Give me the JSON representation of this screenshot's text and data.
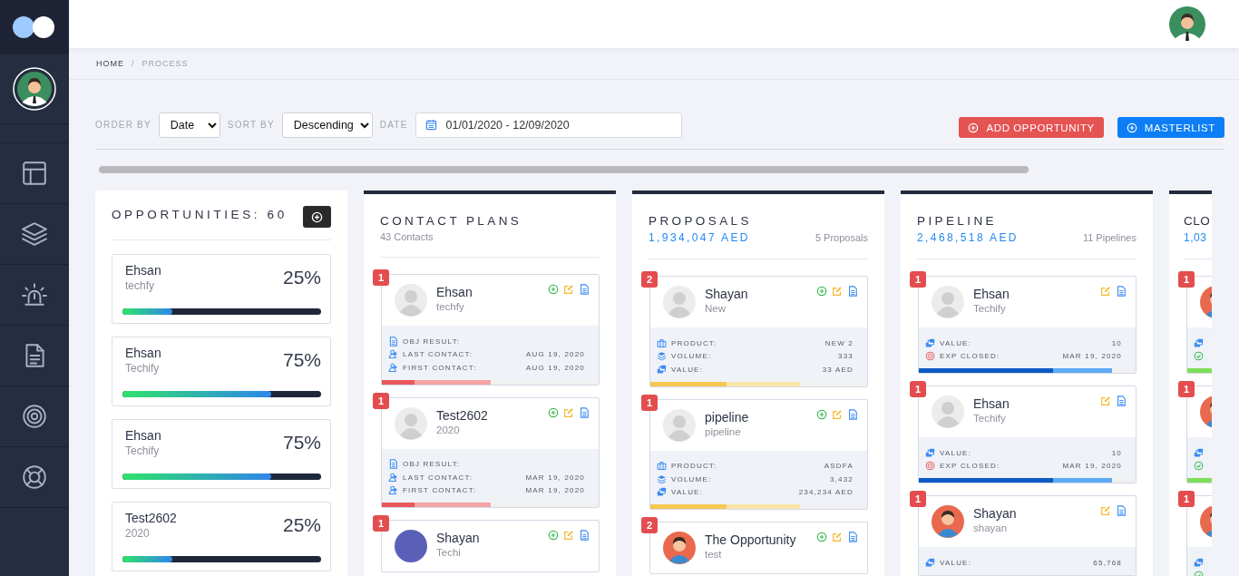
{
  "breadcrumb": {
    "separator": "/",
    "items": [
      {
        "label": "HOME",
        "current": false
      },
      {
        "label": "PROCESS",
        "current": true
      }
    ]
  },
  "filters": [
    {
      "label": "ORDER BY",
      "kind": "select",
      "value": "Date"
    },
    {
      "label": "SORT BY",
      "kind": "select",
      "value": "Descending"
    },
    {
      "label": "DATE",
      "kind": "daterange",
      "value": "01/01/2020 - 12/09/2020"
    }
  ],
  "actions": [
    {
      "label": "ADD OPPORTUNITY",
      "kind": "danger"
    },
    {
      "label": "MASTERLIST",
      "kind": "primary"
    }
  ],
  "opportunities": {
    "title": "OPPORTUNITIES: 60",
    "items": [
      {
        "name": "Ehsan",
        "company": "techfy",
        "percent": "25%",
        "level": 0.25
      },
      {
        "name": "Ehsan",
        "company": "Techify",
        "percent": "75%",
        "level": 0.75
      },
      {
        "name": "Ehsan",
        "company": "Techify",
        "percent": "75%",
        "level": 0.75
      },
      {
        "name": "Test2602",
        "company": "2020",
        "percent": "25%",
        "level": 0.25
      }
    ]
  },
  "stages": [
    {
      "kind": "contact",
      "title": "CONTACT PLANS",
      "count": "43 Contacts",
      "cards": [
        {
          "badge": "1",
          "avatar": {
            "kind": "placeholder"
          },
          "name": "Ehsan",
          "subtitle": "techfy",
          "actions": [
            {
              "kind": "add"
            },
            {
              "kind": "edit"
            },
            {
              "kind": "doc"
            }
          ],
          "fields": [
            {
              "kind": "doc",
              "label": "OBJ RESULT:"
            },
            {
              "kind": "contacts",
              "label": "LAST CONTACT:",
              "value": "AUG 19, 2020"
            },
            {
              "kind": "contacts",
              "label": "FIRST CONTACT:",
              "value": "AUG 19, 2020"
            }
          ],
          "progress": [
            {
              "level": 0.5
            },
            {
              "level": 0.15
            }
          ]
        },
        {
          "badge": "1",
          "avatar": {
            "kind": "placeholder"
          },
          "name": "Test2602",
          "subtitle": "2020",
          "actions": [
            {
              "kind": "add"
            },
            {
              "kind": "edit"
            },
            {
              "kind": "doc"
            }
          ],
          "fields": [
            {
              "kind": "doc",
              "label": "OBJ RESULT:"
            },
            {
              "kind": "contacts",
              "label": "LAST CONTACT:",
              "value": "MAR 19, 2020"
            },
            {
              "kind": "contacts",
              "label": "FIRST CONTACT:",
              "value": "MAR 19, 2020"
            }
          ],
          "progress": [
            {
              "level": 0.5
            },
            {
              "level": 0.15
            }
          ]
        },
        {
          "badge": "1",
          "avatar": {
            "kind": "photo"
          },
          "name": "Shayan",
          "subtitle": "Techi",
          "actions": [
            {
              "kind": "add"
            },
            {
              "kind": "edit"
            },
            {
              "kind": "doc"
            }
          ]
        }
      ]
    },
    {
      "kind": "proposal",
      "title": "PROPOSALS",
      "amount": "1,934,047 AED",
      "count": "5 Proposals",
      "cards": [
        {
          "badge": "2",
          "avatar": {
            "kind": "placeholder"
          },
          "name": "Shayan",
          "subtitle": "New",
          "actions": [
            {
              "kind": "add"
            },
            {
              "kind": "edit"
            },
            {
              "kind": "doc"
            }
          ],
          "fields": [
            {
              "kind": "product",
              "label": "PRODUCT:",
              "value": "NEW 2"
            },
            {
              "kind": "layers",
              "label": "VOLUME:",
              "value": "333"
            },
            {
              "kind": "money",
              "label": "VALUE:",
              "value": "33 AED"
            }
          ],
          "progress": [
            {
              "level": 0.69
            },
            {
              "level": 0.35
            }
          ]
        },
        {
          "badge": "1",
          "avatar": {
            "kind": "placeholder"
          },
          "name": "pipeline",
          "subtitle": "pipeline",
          "actions": [
            {
              "kind": "add"
            },
            {
              "kind": "edit"
            },
            {
              "kind": "doc"
            }
          ],
          "fields": [
            {
              "kind": "product",
              "label": "PRODUCT:",
              "value": "ASDFA"
            },
            {
              "kind": "layers",
              "label": "VOLUME:",
              "value": "3,432"
            },
            {
              "kind": "money",
              "label": "VALUE:",
              "value": "234,234 AED"
            }
          ],
          "progress": [
            {
              "level": 0.69
            },
            {
              "level": 0.35
            }
          ]
        },
        {
          "badge": "2",
          "avatar": {
            "kind": "illustration"
          },
          "name": "The Opportunity",
          "subtitle": "test",
          "actions": [
            {
              "kind": "add"
            },
            {
              "kind": "edit"
            },
            {
              "kind": "doc"
            }
          ]
        }
      ]
    },
    {
      "kind": "pipeline",
      "title": "PIPELINE",
      "amount": "2,468,518 AED",
      "count": "11 Pipelines",
      "cards": [
        {
          "badge": "1",
          "avatar": {
            "kind": "placeholder"
          },
          "name": "Ehsan",
          "subtitle": "Techify",
          "actions": [
            {
              "kind": "edit"
            },
            {
              "kind": "doc"
            }
          ],
          "fields": [
            {
              "kind": "money",
              "label": "VALUE:",
              "value": "10"
            },
            {
              "kind": "target",
              "label": "EXP CLOSED:",
              "value": "MAR 19, 2020"
            }
          ],
          "progress": [
            {
              "level": 0.89
            },
            {
              "level": 0.62
            }
          ]
        },
        {
          "badge": "1",
          "avatar": {
            "kind": "placeholder"
          },
          "name": "Ehsan",
          "subtitle": "Techify",
          "actions": [
            {
              "kind": "edit"
            },
            {
              "kind": "doc"
            }
          ],
          "fields": [
            {
              "kind": "money",
              "label": "VALUE:",
              "value": "10"
            },
            {
              "kind": "target",
              "label": "EXP CLOSED:",
              "value": "MAR 19, 2020"
            }
          ],
          "progress": [
            {
              "level": 0.89
            },
            {
              "level": 0.62
            }
          ]
        },
        {
          "badge": "1",
          "avatar": {
            "kind": "illustration"
          },
          "name": "Shayan",
          "subtitle": "shayan",
          "actions": [
            {
              "kind": "edit"
            },
            {
              "kind": "doc"
            }
          ],
          "fields": [
            {
              "kind": "money",
              "label": "VALUE:",
              "value": "65,768"
            }
          ]
        }
      ]
    },
    {
      "kind": "closed",
      "title": "CLO",
      "amount": "1,03",
      "cards": [
        {
          "badge": "1",
          "avatar": {
            "kind": "illustration"
          },
          "fields": [
            {
              "kind": "money"
            },
            {
              "kind": "check"
            }
          ],
          "progress": [
            {
              "level": 1
            }
          ]
        },
        {
          "badge": "1",
          "avatar": {
            "kind": "illustration"
          },
          "fields": [
            {
              "kind": "money"
            },
            {
              "kind": "check"
            }
          ],
          "progress": [
            {
              "level": 1
            }
          ]
        },
        {
          "badge": "1",
          "avatar": {
            "kind": "illustration"
          },
          "fields": [
            {
              "kind": "money"
            },
            {
              "kind": "check"
            }
          ]
        }
      ]
    }
  ]
}
